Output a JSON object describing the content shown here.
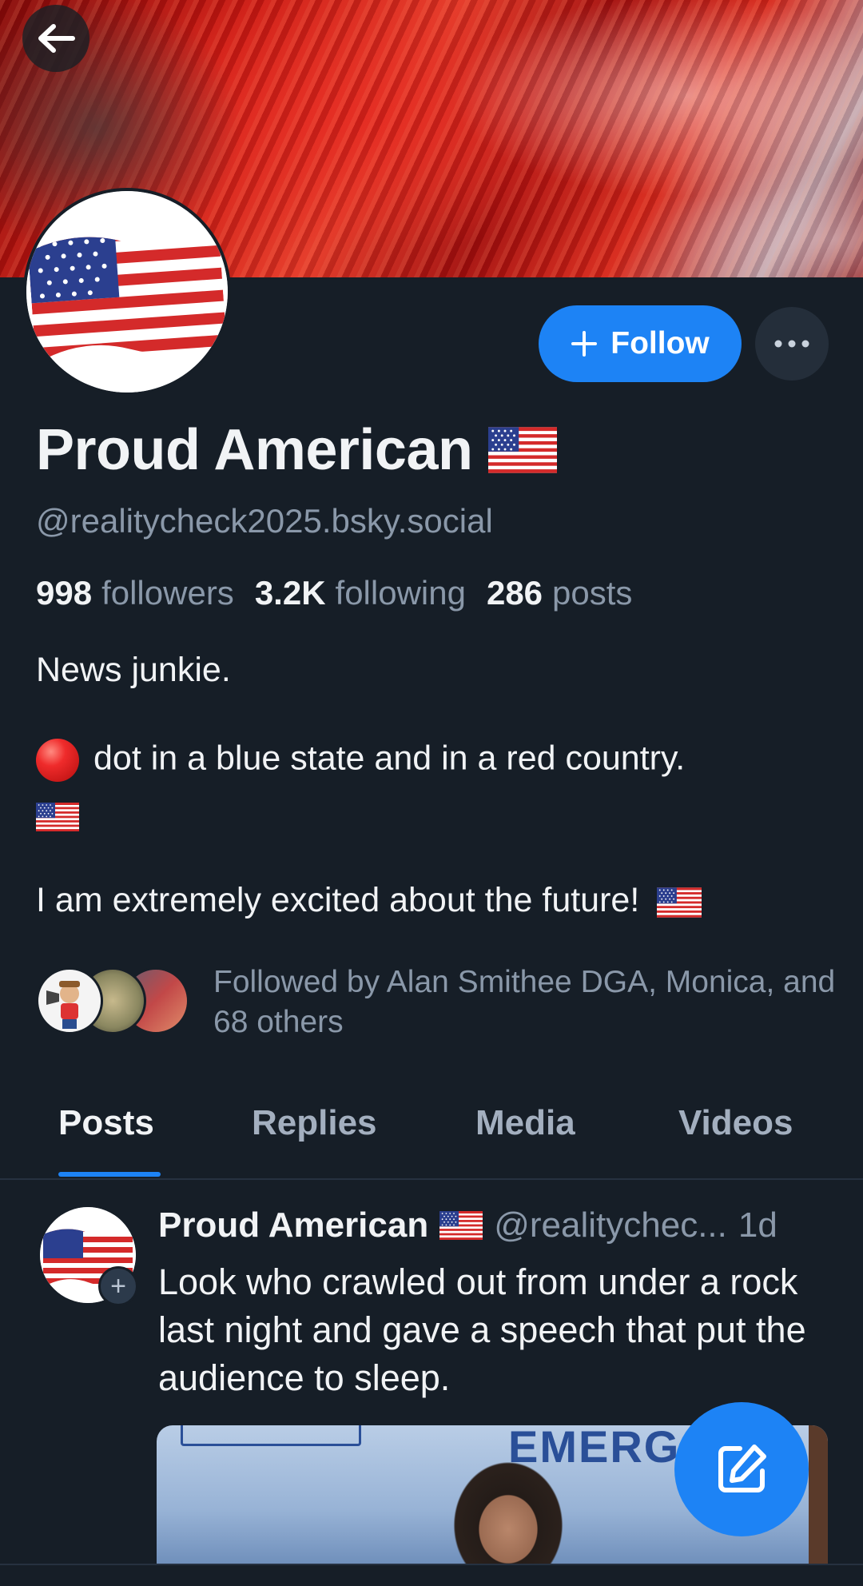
{
  "profile": {
    "display_name": "Proud American",
    "handle": "@realitycheck2025.bsky.social",
    "followers_count": "998",
    "followers_label": "followers",
    "following_count": "3.2K",
    "following_label": "following",
    "posts_count": "286",
    "posts_label": "posts",
    "bio_line1": "News junkie.",
    "bio_line2": "dot in a blue state and in a red country.",
    "bio_line3": "I am extremely excited about the future!",
    "followed_by": "Followed by Alan Smithee DGA, Monica, and 68 others"
  },
  "actions": {
    "follow_label": "Follow"
  },
  "tabs": [
    {
      "label": "Posts",
      "active": true
    },
    {
      "label": "Replies",
      "active": false
    },
    {
      "label": "Media",
      "active": false
    },
    {
      "label": "Videos",
      "active": false
    }
  ],
  "post": {
    "author_name": "Proud American",
    "author_handle": "@realitychec...",
    "time": "1d",
    "text": "Look who crawled out from under a rock last night and gave a speech that put the audience to sleep.",
    "image_text": "EMERG"
  },
  "colors": {
    "accent": "#1d83f5",
    "background": "#161e27",
    "muted_text": "#8a98a9"
  },
  "icons": [
    "back-arrow-icon",
    "plus-icon",
    "more-icon",
    "flag-emoji-icon",
    "red-dot-emoji-icon",
    "compose-icon"
  ]
}
